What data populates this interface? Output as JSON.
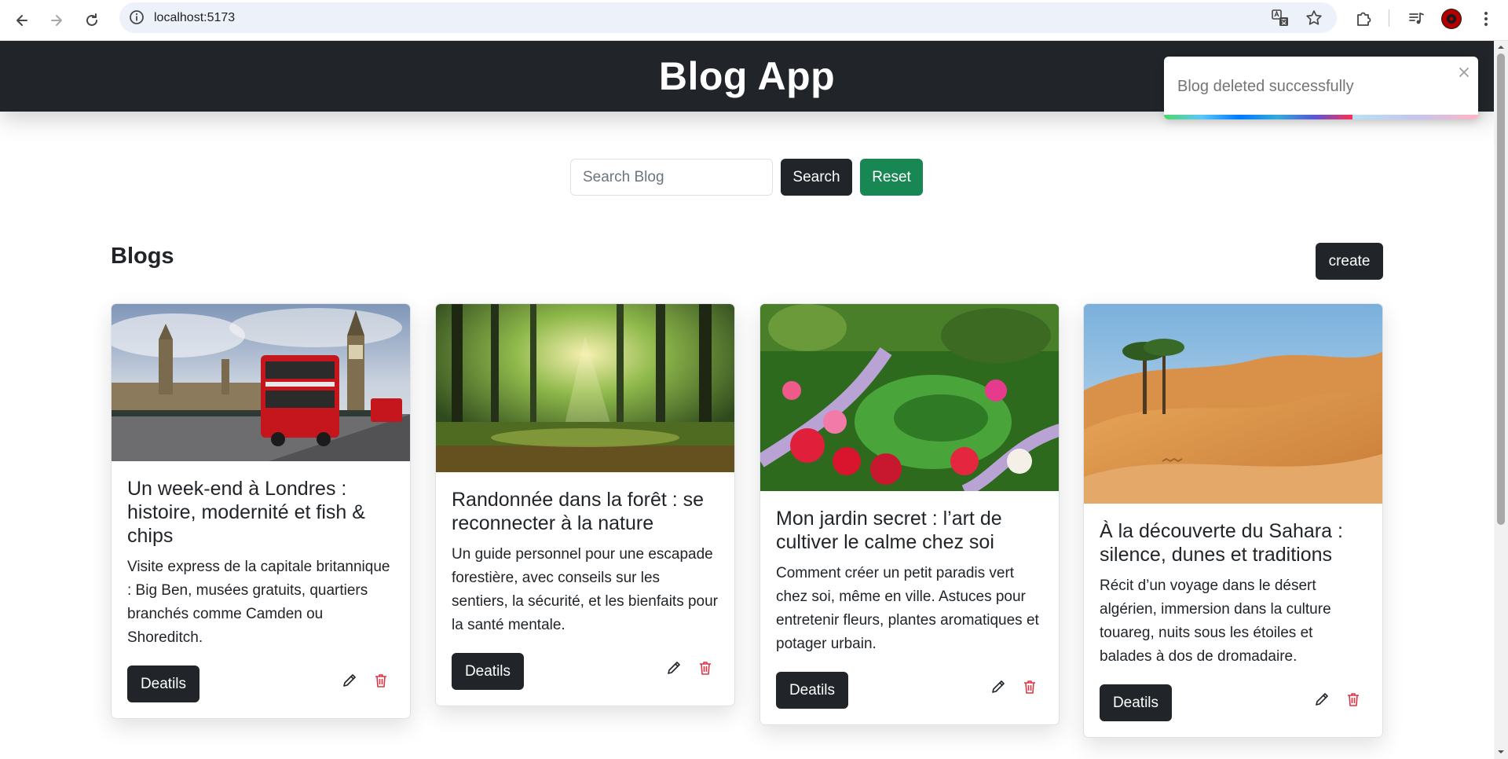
{
  "browser": {
    "url": "localhost:5173"
  },
  "navbar": {
    "brand": "Blog App"
  },
  "search": {
    "placeholder": "Search Blog",
    "value": "",
    "search_label": "Search",
    "reset_label": "Reset"
  },
  "blogs": {
    "heading": "Blogs",
    "create_label": "create",
    "cards": [
      {
        "title": "Un week-end à Londres : histoire, modernité et fish & chips",
        "description": "Visite express de la capitale britannique : Big Ben, musées gratuits, quartiers branchés comme Camden ou Shoreditch.",
        "details_label": "Deatils"
      },
      {
        "title": "Randonnée dans la forêt : se reconnecter à la nature",
        "description": "Un guide personnel pour une escapade forestière, avec conseils sur les sentiers, la sécurité, et les bienfaits pour la santé mentale.",
        "details_label": "Deatils"
      },
      {
        "title": "Mon jardin secret : l’art de cultiver le calme chez soi",
        "description": "Comment créer un petit paradis vert chez soi, même en ville. Astuces pour entretenir fleurs, plantes aromatiques et potager urbain.",
        "details_label": "Deatils"
      },
      {
        "title": "À la découverte du Sahara : silence, dunes et traditions",
        "description": "Récit d’un voyage dans le désert algérien, immersion dans la culture touareg, nuits sous les étoiles et balades à dos de dromadaire.",
        "details_label": "Deatils"
      }
    ]
  },
  "toast": {
    "message": "Blog deleted successfully",
    "progress": 0.6
  },
  "colors": {
    "navbar": "#212529",
    "dark_button": "#212529",
    "reset_button": "#198754",
    "delete_icon": "#dc3545"
  },
  "icons": {
    "back": "arrow-left-icon",
    "forward": "arrow-right-icon",
    "reload": "reload-icon",
    "site_info": "info-icon",
    "translate": "translate-icon",
    "bookmark": "star-icon",
    "extensions": "puzzle-icon",
    "media": "media-icon",
    "menu": "kebab-menu-icon",
    "edit": "pencil-icon",
    "delete": "trash-icon",
    "close": "close-icon"
  }
}
